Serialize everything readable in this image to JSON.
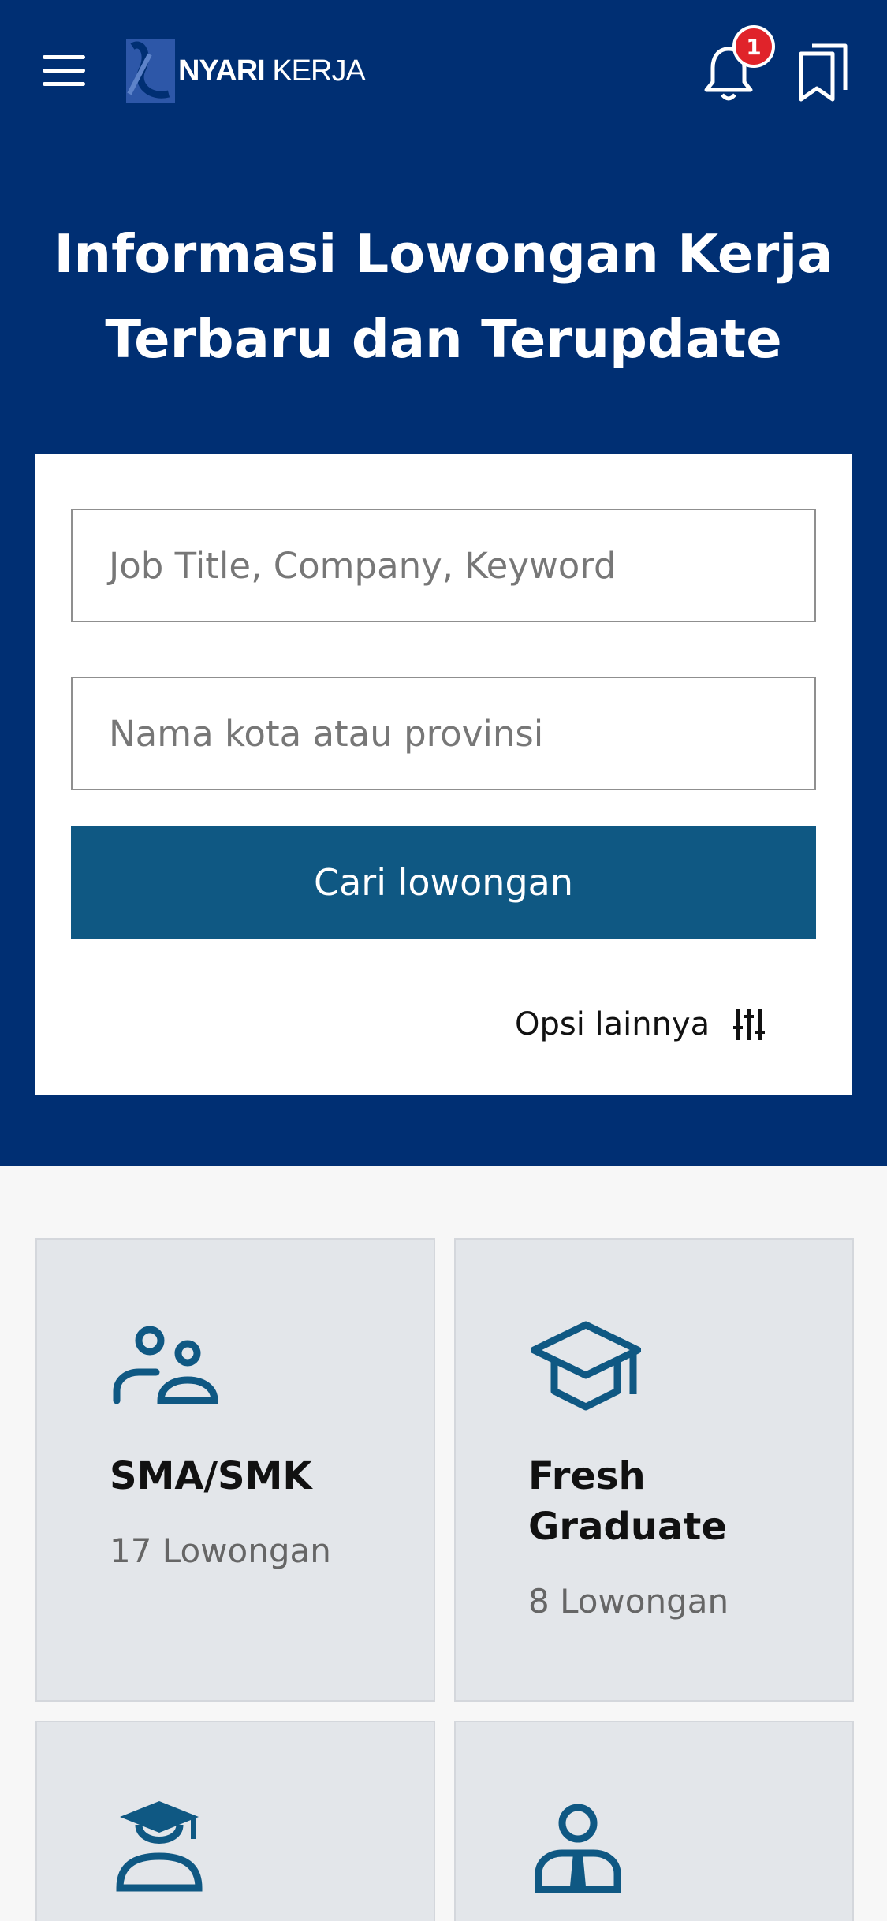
{
  "header": {
    "logo_text_bold": "NYARI",
    "logo_text_light": "KERJA",
    "notification_count": "1"
  },
  "hero": {
    "headline": "Informasi Lowongan Kerja Terbaru dan Terupdate"
  },
  "search": {
    "keyword_placeholder": "Job Title, Company, Keyword",
    "location_placeholder": "Nama kota atau provinsi",
    "submit_label": "Cari lowongan",
    "more_options_label": "Opsi lainnya"
  },
  "categories": [
    {
      "title": "SMA/SMK",
      "count": "17 Lowongan",
      "icon": "users-icon"
    },
    {
      "title": "Fresh Graduate",
      "count": "8 Lowongan",
      "icon": "graduation-cap-icon"
    },
    {
      "title": "",
      "count": "",
      "icon": "student-icon"
    },
    {
      "title": "",
      "count": "",
      "icon": "employee-icon"
    }
  ],
  "colors": {
    "hero_bg": "#002f73",
    "button_bg": "#0f5883",
    "icon_color": "#0f5883",
    "badge": "#e0232a",
    "card_bg": "#e3e6ea"
  }
}
